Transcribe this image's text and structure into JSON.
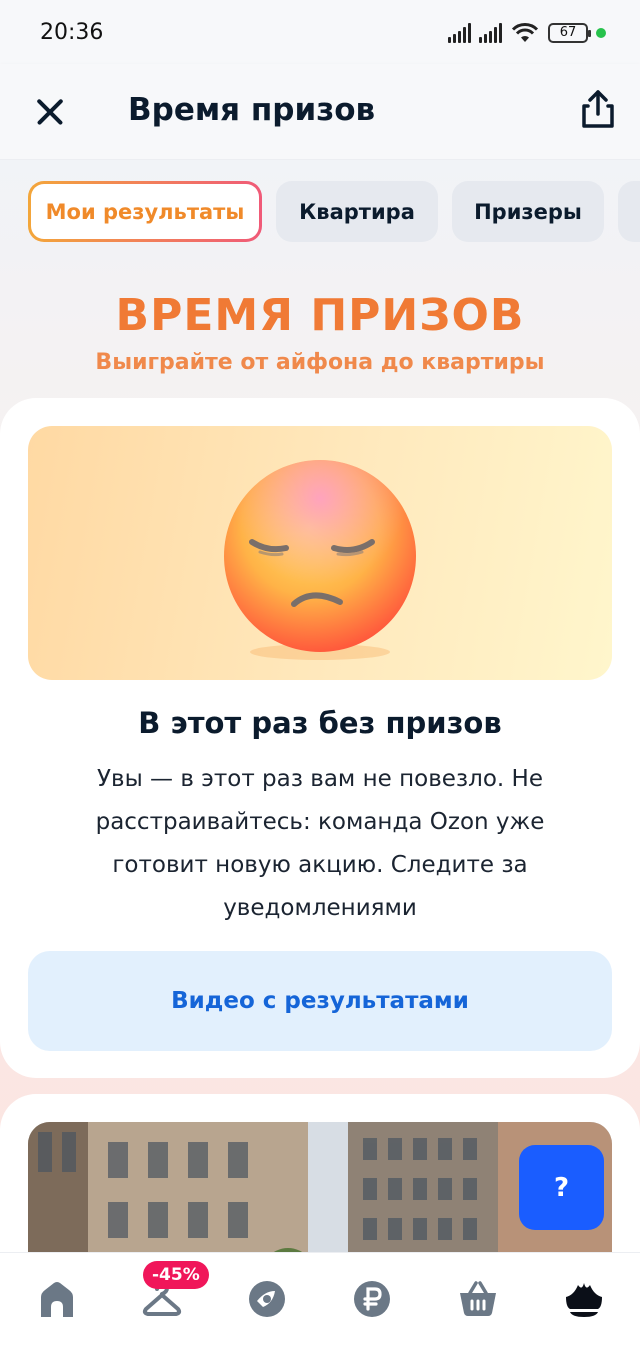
{
  "status_bar": {
    "time": "20:36",
    "battery": "67",
    "icons": [
      "signal-icon",
      "signal-icon",
      "wifi-icon",
      "battery-icon",
      "dot-icon"
    ]
  },
  "header": {
    "title": "Время призов",
    "close_icon": "close-icon",
    "share_icon": "share-icon"
  },
  "tabs": [
    {
      "label": "Мои результаты",
      "active": true
    },
    {
      "label": "Квартира",
      "active": false
    },
    {
      "label": "Призеры",
      "active": false
    },
    {
      "label": "",
      "active": false
    }
  ],
  "hero": {
    "title": "ВРЕМЯ ПРИЗОВ",
    "subtitle": "Выиграйте от айфона до квартиры"
  },
  "result_card": {
    "image_icon": "sad-face-icon",
    "title": "В этот раз без призов",
    "text": "Увы — в этот раз вам не повезло. Не расстраивайтесь: команда Ozon уже готовит новую акцию. Следите за уведомлениями",
    "button_label": "Видео с результатами"
  },
  "help_button": {
    "label": "?"
  },
  "bottom_nav": {
    "items": [
      {
        "icon": "home-icon"
      },
      {
        "icon": "hanger-icon",
        "badge": "-45%"
      },
      {
        "icon": "fresh-icon"
      },
      {
        "icon": "ruble-icon"
      },
      {
        "icon": "cart-icon"
      },
      {
        "icon": "crown-icon"
      }
    ]
  },
  "colors": {
    "accent_orange": "#f07a35",
    "link_blue": "#1565d8",
    "help_blue": "#1a5dff",
    "badge_pink": "#f0165a",
    "text_dark": "#0b1b2d"
  }
}
